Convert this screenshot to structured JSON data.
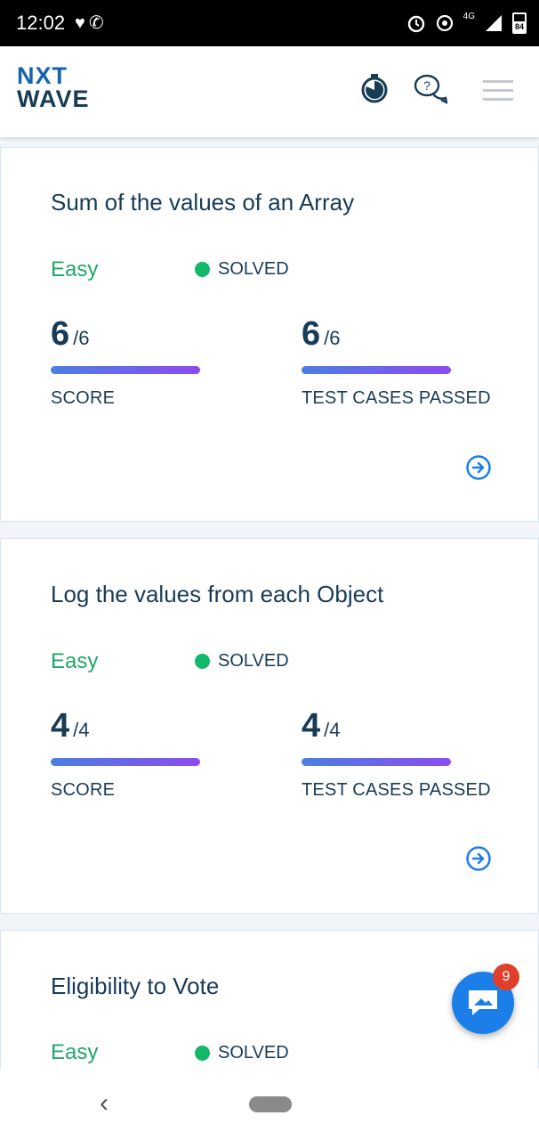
{
  "status_bar": {
    "time": "12:02",
    "battery": "84",
    "network": "4G"
  },
  "app": {
    "logo_line1": "NXT",
    "logo_line2": "WAVE",
    "colors": {
      "accent": "#1564b0",
      "text": "#183b56",
      "easy": "#21a869",
      "solved_dot": "#12b76a"
    },
    "icons": [
      "stopwatch-icon",
      "help-chat-icon",
      "menu-icon"
    ]
  },
  "cards": [
    {
      "title": "Sum of the values of an Array",
      "difficulty": "Easy",
      "status": "SOLVED",
      "score": {
        "value": "6",
        "total": "/6",
        "label": "SCORE",
        "fraction": 1.0
      },
      "tests": {
        "value": "6",
        "total": "/6",
        "label": "TEST CASES PASSED",
        "fraction": 1.0
      }
    },
    {
      "title": "Log the values from each Object",
      "difficulty": "Easy",
      "status": "SOLVED",
      "score": {
        "value": "4",
        "total": "/4",
        "label": "SCORE",
        "fraction": 1.0
      },
      "tests": {
        "value": "4",
        "total": "/4",
        "label": "TEST CASES PASSED",
        "fraction": 1.0
      }
    },
    {
      "title": "Eligibility to Vote",
      "difficulty": "Easy",
      "status": "SOLVED"
    }
  ],
  "chat": {
    "badge_count": "9"
  }
}
